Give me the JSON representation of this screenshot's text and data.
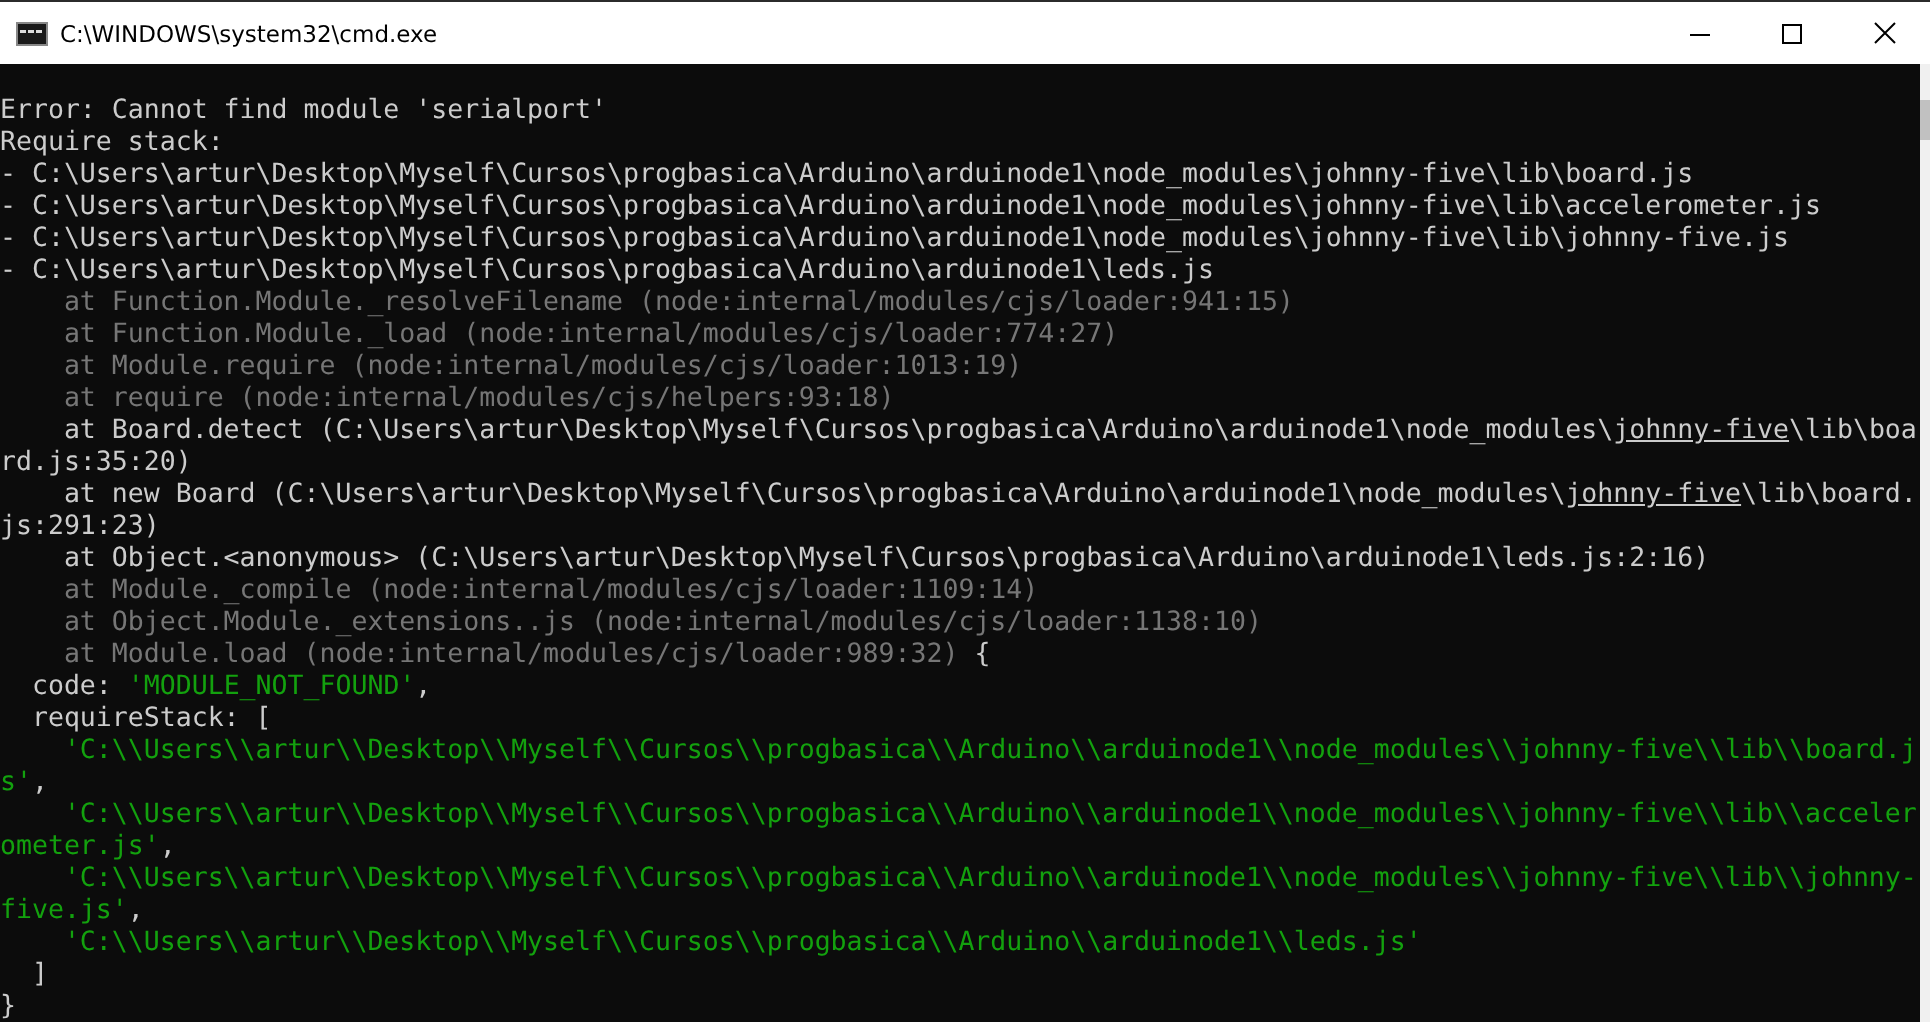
{
  "window": {
    "title": "C:\\WINDOWS\\system32\\cmd.exe"
  },
  "console": {
    "lines": [
      [
        {
          "kind": "text",
          "text": "Error: Cannot find module 'serialport'"
        }
      ],
      [
        {
          "kind": "text",
          "text": "Require stack:"
        }
      ],
      [
        {
          "kind": "text",
          "text": "- C:\\Users\\artur\\Desktop\\Myself\\Cursos\\progbasica\\Arduino\\arduinode1\\node_modules\\johnny-five\\lib\\board.js"
        }
      ],
      [
        {
          "kind": "text",
          "text": "- C:\\Users\\artur\\Desktop\\Myself\\Cursos\\progbasica\\Arduino\\arduinode1\\node_modules\\johnny-five\\lib\\accelerometer.js"
        }
      ],
      [
        {
          "kind": "text",
          "text": "- C:\\Users\\artur\\Desktop\\Myself\\Cursos\\progbasica\\Arduino\\arduinode1\\node_modules\\johnny-five\\lib\\johnny-five.js"
        }
      ],
      [
        {
          "kind": "text",
          "text": "- C:\\Users\\artur\\Desktop\\Myself\\Cursos\\progbasica\\Arduino\\arduinode1\\leds.js"
        }
      ],
      [
        {
          "kind": "dim",
          "text": "    at Function.Module._resolveFilename (node:internal/modules/cjs/loader:941:15)"
        }
      ],
      [
        {
          "kind": "dim",
          "text": "    at Function.Module._load (node:internal/modules/cjs/loader:774:27)"
        }
      ],
      [
        {
          "kind": "dim",
          "text": "    at Module.require (node:internal/modules/cjs/loader:1013:19)"
        }
      ],
      [
        {
          "kind": "dim",
          "text": "    at require (node:internal/modules/cjs/helpers:93:18)"
        }
      ],
      [
        {
          "kind": "text",
          "text": "    at Board.detect (C:\\Users\\artur\\Desktop\\Myself\\Cursos\\progbasica\\Arduino\\arduinode1\\node_modules\\",
          "underlined": false
        },
        {
          "kind": "text",
          "text": "johnny-five",
          "underlined": true
        },
        {
          "kind": "text",
          "text": "\\lib\\boa",
          "underlined": false
        }
      ],
      [
        {
          "kind": "text",
          "text": "rd.js:35:20)"
        }
      ],
      [
        {
          "kind": "text",
          "text": "    at new Board (C:\\Users\\artur\\Desktop\\Myself\\Cursos\\progbasica\\Arduino\\arduinode1\\node_modules\\",
          "underlined": false
        },
        {
          "kind": "text",
          "text": "johnny-five",
          "underlined": true
        },
        {
          "kind": "text",
          "text": "\\lib\\board.",
          "underlined": false
        }
      ],
      [
        {
          "kind": "text",
          "text": "js:291:23)"
        }
      ],
      [
        {
          "kind": "text",
          "text": "    at Object.<anonymous> (C:\\Users\\artur\\Desktop\\Myself\\Cursos\\progbasica\\Arduino\\arduinode1\\leds.js:2:16)"
        }
      ],
      [
        {
          "kind": "dim",
          "text": "    at Module._compile (node:internal/modules/cjs/loader:1109:14)"
        }
      ],
      [
        {
          "kind": "dim",
          "text": "    at Object.Module._extensions..js (node:internal/modules/cjs/loader:1138:10)"
        }
      ],
      [
        {
          "kind": "dim",
          "text": "    at Module.load (node:internal/modules/cjs/loader:989:32)"
        },
        {
          "kind": "text",
          "text": " {"
        }
      ],
      [
        {
          "kind": "text",
          "text": "  code: "
        },
        {
          "kind": "string",
          "text": "'MODULE_NOT_FOUND'"
        },
        {
          "kind": "text",
          "text": ","
        }
      ],
      [
        {
          "kind": "text",
          "text": "  requireStack: ["
        }
      ],
      [
        {
          "kind": "string",
          "text": "    'C:\\\\Users\\\\artur\\\\Desktop\\\\Myself\\\\Cursos\\\\progbasica\\\\Arduino\\\\arduinode1\\\\node_modules\\\\johnny-five\\\\lib\\\\board.j"
        }
      ],
      [
        {
          "kind": "string",
          "text": "s'"
        },
        {
          "kind": "text",
          "text": ","
        }
      ],
      [
        {
          "kind": "string",
          "text": "    'C:\\\\Users\\\\artur\\\\Desktop\\\\Myself\\\\Cursos\\\\progbasica\\\\Arduino\\\\arduinode1\\\\node_modules\\\\johnny-five\\\\lib\\\\acceler"
        }
      ],
      [
        {
          "kind": "string",
          "text": "ometer.js'"
        },
        {
          "kind": "text",
          "text": ","
        }
      ],
      [
        {
          "kind": "string",
          "text": "    'C:\\\\Users\\\\artur\\\\Desktop\\\\Myself\\\\Cursos\\\\progbasica\\\\Arduino\\\\arduinode1\\\\node_modules\\\\johnny-five\\\\lib\\\\johnny-"
        }
      ],
      [
        {
          "kind": "string",
          "text": "five.js'"
        },
        {
          "kind": "text",
          "text": ","
        }
      ],
      [
        {
          "kind": "string",
          "text": "    'C:\\\\Users\\\\artur\\\\Desktop\\\\Myself\\\\Cursos\\\\progbasica\\\\Arduino\\\\arduinode1\\\\leds.js'"
        }
      ],
      [
        {
          "kind": "text",
          "text": "  ]"
        }
      ],
      [
        {
          "kind": "text",
          "text": "}"
        }
      ]
    ]
  }
}
